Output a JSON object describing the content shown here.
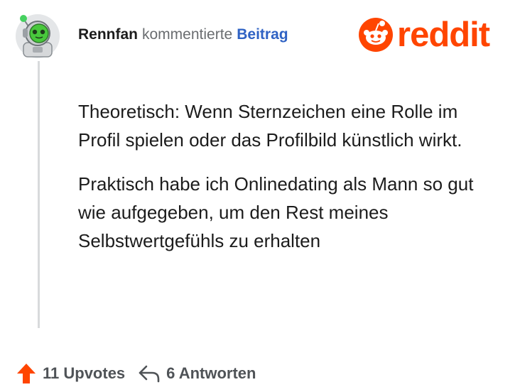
{
  "header": {
    "author": "Rennfan",
    "action": "kommentierte",
    "post_link": "Beitrag"
  },
  "brand": {
    "name": "reddit",
    "color": "#ff4500"
  },
  "comment": {
    "paragraphs": [
      "Theoretisch: Wenn Sternzeichen eine Rolle im Profil spielen oder das Profilbild künstlich wirkt.",
      "Praktisch habe ich Onlinedating als Mann so gut wie aufgegeben, um den Rest meines Selbstwertgefühls zu erhalten"
    ]
  },
  "footer": {
    "upvotes": "11 Upvotes",
    "replies": "6 Antworten",
    "upvote_icon": "arrow-up-icon",
    "reply_icon": "reply-arrow-icon",
    "upvote_color": "#ff4500"
  },
  "avatar": {
    "icon": "robot-avatar-icon"
  }
}
